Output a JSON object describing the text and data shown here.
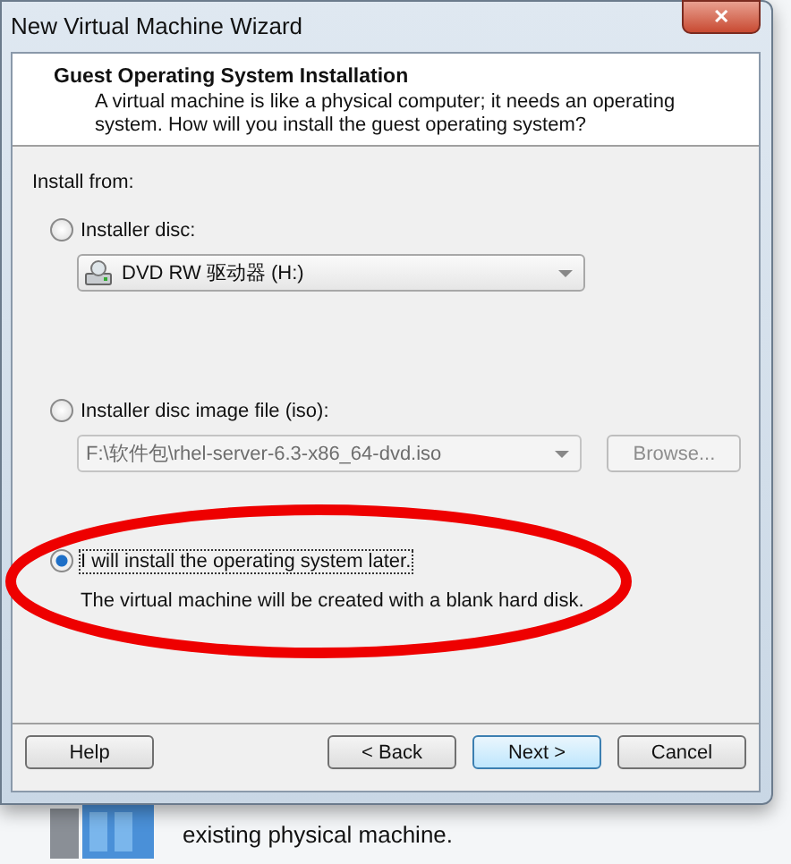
{
  "window": {
    "title": "New Virtual Machine Wizard",
    "close": "✕"
  },
  "header": {
    "title": "Guest Operating System Installation",
    "description": "A virtual machine is like a physical computer; it needs an operating system. How will you install the guest operating system?"
  },
  "install_from": {
    "label": "Install from:",
    "options": [
      {
        "kind": "disc",
        "label": "Installer disc:",
        "selected": false,
        "dropdown": {
          "value": "DVD RW 驱动器 (H:)",
          "disabled": false
        }
      },
      {
        "kind": "iso",
        "label": "Installer disc image file (iso):",
        "selected": false,
        "field": {
          "value": "F:\\软件包\\rhel-server-6.3-x86_64-dvd.iso",
          "disabled": true
        },
        "browse": {
          "label": "Browse...",
          "disabled": true
        }
      },
      {
        "kind": "later",
        "label": "I will install the operating system later.",
        "selected": true,
        "description": "The virtual machine will be created with a blank hard disk."
      }
    ]
  },
  "buttons": [
    {
      "label": "Help",
      "default": false
    },
    {
      "label": "< Back",
      "default": false
    },
    {
      "label": "Next >",
      "default": true
    },
    {
      "label": "Cancel",
      "default": false
    }
  ],
  "background": {
    "text": "existing physical machine."
  }
}
